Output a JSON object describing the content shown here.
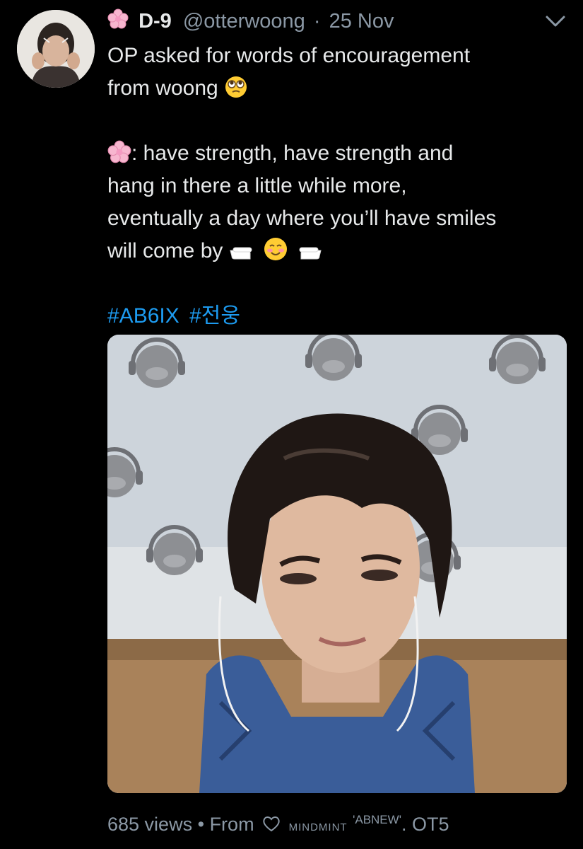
{
  "tweet": {
    "display_name": "D-9",
    "handle": "@otterwoong",
    "separator": "·",
    "date": "25 Nov",
    "text_line1": "OP asked for words of encouragement",
    "text_line2": "from woong",
    "quote_prefix": ":",
    "quote_line1": " have strength, have strength and",
    "quote_line2": "hang in there a little while more,",
    "quote_line3": "eventually a day where you’ll have smiles",
    "quote_line4": "will come by ",
    "hashtags": [
      "#AB6IX",
      "#전웅"
    ]
  },
  "footer": {
    "views": "685 views",
    "dot": "•",
    "from": "From",
    "source_name": "mindmint",
    "source_quote": "'ABNEW'",
    "source_suffix": ". OT5"
  },
  "icons": {
    "flower": "cherry-blossom-icon",
    "menu": "chevron-down-icon",
    "heart": "heart-outline-icon",
    "emoji_eyes": "pleading-eyes-emoji",
    "emoji_hands": "pointing-hands-emoji",
    "emoji_smile": "smiling-blush-emoji"
  },
  "colors": {
    "background": "#000000",
    "text": "#e7e9ea",
    "muted": "#8b98a5",
    "link": "#1d9bf0"
  }
}
